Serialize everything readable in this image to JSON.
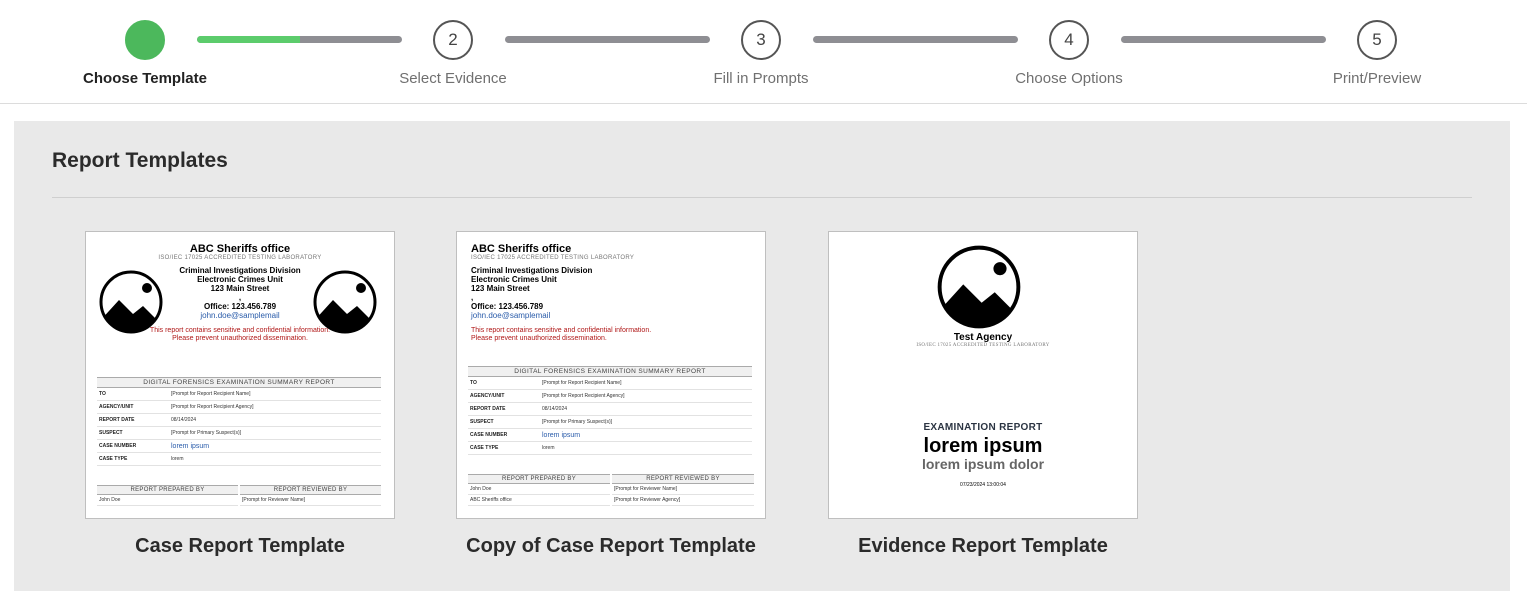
{
  "steps": [
    {
      "number": "",
      "label": "Choose Template",
      "state": "done"
    },
    {
      "number": "2",
      "label": "Select Evidence",
      "state": "pending"
    },
    {
      "number": "3",
      "label": "Fill in Prompts",
      "state": "pending"
    },
    {
      "number": "4",
      "label": "Choose Options",
      "state": "pending"
    },
    {
      "number": "5",
      "label": "Print/Preview",
      "state": "pending"
    }
  ],
  "progress": {
    "bar1_fill_percent": 50
  },
  "colors": {
    "step_done": "#4cb85c",
    "bar_fill": "#5ccc6c",
    "bar_track": "#8e8e93",
    "warning_text": "#b01818",
    "link_text": "#2a5caa"
  },
  "section_title": "Report Templates",
  "templates": [
    {
      "title": "Case Report Template",
      "preview": {
        "agency": "ABC Sheriffs office",
        "accreditation": "ISO/IEC 17025 ACCREDITED TESTING LABORATORY",
        "division": "Criminal Investigations Division",
        "unit": "Electronic Crimes Unit",
        "address": "123 Main Street",
        "comma": ",",
        "office": "Office: 123.456.789",
        "email": "john.doe@samplemail",
        "warning1": "This report contains sensitive and confidential information.",
        "warning2": "Please prevent unauthorized dissemination.",
        "table_header": "DIGITAL FORENSICS EXAMINATION SUMMARY REPORT",
        "rows": [
          {
            "k": "TO",
            "v": "[Prompt for Report Recipient Name]"
          },
          {
            "k": "AGENCY/UNIT",
            "v": "[Prompt for Report Recipient Agency]"
          },
          {
            "k": "REPORT DATE",
            "v": "08/14/2024"
          },
          {
            "k": "SUSPECT",
            "v": "[Prompt for Primary Suspect(s)]"
          },
          {
            "k": "CASE NUMBER",
            "v": "lorem ipsum"
          },
          {
            "k": "CASE TYPE",
            "v": "lorem"
          }
        ],
        "prepared_header": "REPORT PREPARED BY",
        "reviewed_header": "REPORT REVIEWED BY",
        "prepared_rows": [
          "John Doe"
        ],
        "reviewed_rows": [
          "[Prompt for Reviewer Name]"
        ]
      }
    },
    {
      "title": "Copy of Case Report Template",
      "preview": {
        "agency": "ABC Sheriffs office",
        "accreditation": "ISO/IEC 17025 ACCREDITED TESTING LABORATORY",
        "division": "Criminal Investigations Division",
        "unit": "Electronic Crimes Unit",
        "address": "123 Main Street",
        "comma": ",",
        "office": "Office: 123.456.789",
        "email": "john.doe@samplemail",
        "warning1": "This report contains sensitive and confidential information.",
        "warning2": "Please prevent unauthorized dissemination.",
        "table_header": "DIGITAL FORENSICS EXAMINATION SUMMARY REPORT",
        "rows": [
          {
            "k": "TO",
            "v": "[Prompt for Report Recipient Name]"
          },
          {
            "k": "AGENCY/UNIT",
            "v": "[Prompt for Report Recipient Agency]"
          },
          {
            "k": "REPORT DATE",
            "v": "08/14/2024"
          },
          {
            "k": "SUSPECT",
            "v": "[Prompt for Primary Suspect(s)]"
          },
          {
            "k": "CASE NUMBER",
            "v": "lorem ipsum"
          },
          {
            "k": "CASE TYPE",
            "v": "lorem"
          }
        ],
        "prepared_header": "REPORT PREPARED BY",
        "reviewed_header": "REPORT REVIEWED BY",
        "prepared_rows": [
          "John Doe",
          "ABC Sheriffs office"
        ],
        "reviewed_rows": [
          "[Prompt for Reviewer Name]",
          "[Prompt for Reviewer Agency]"
        ]
      }
    },
    {
      "title": "Evidence Report Template",
      "preview": {
        "agency": "Test Agency",
        "accreditation": "ISO/IEC 17025 ACCREDITED TESTING LABORATORY",
        "report_label": "EXAMINATION REPORT",
        "main": "lorem ipsum",
        "sub": "lorem ipsum dolor",
        "timestamp": "07/23/2024 13:00:04"
      }
    }
  ]
}
